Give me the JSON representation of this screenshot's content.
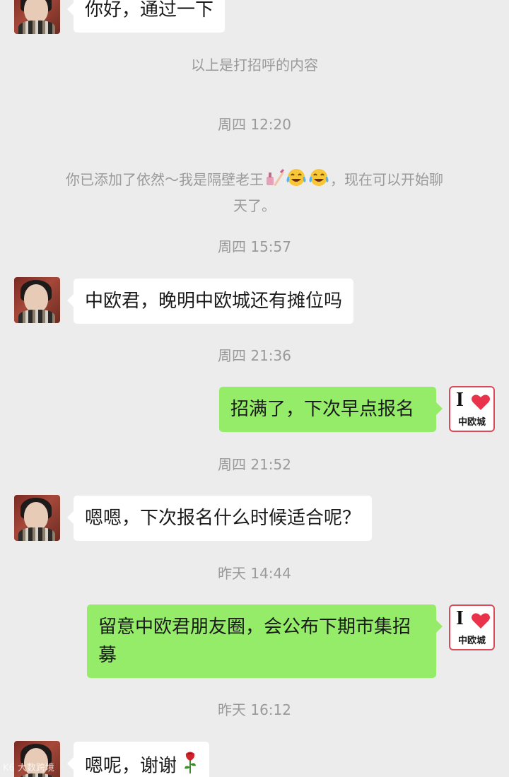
{
  "messages": {
    "m1": "你好，通过一下",
    "greeting_note": "以上是打招呼的内容",
    "ts1": "周四 12:20",
    "added_prefix": "你已添加了依然～我是隔壁老王",
    "added_suffix": "，现在可以开始聊",
    "added_line2": "天了。",
    "ts2": "周四 15:57",
    "m2": "中欧君，晚明中欧城还有摊位吗",
    "ts3": "周四 21:36",
    "m3": "招满了，下次早点报名",
    "ts4": "周四 21:52",
    "m4": "嗯嗯，下次报名什么时候适合呢？",
    "ts5": "昨天 14:44",
    "m5": "留意中欧君朋友圈，会公布下期市集招募",
    "ts6": "昨天 16:12",
    "m6": "嗯呢，谢谢"
  },
  "logo": {
    "letter": "I",
    "text": "中欧城",
    "heart_color": "#e8334a"
  },
  "icons": {
    "nail_polish": "nail-polish-icon",
    "tears_of_joy": "tears-of-joy-icon",
    "rose": "rose-icon"
  },
  "colors": {
    "incoming": "#ffffff",
    "outgoing": "#95ec69",
    "background": "#ececec"
  },
  "watermark": "K6 大数跨境"
}
